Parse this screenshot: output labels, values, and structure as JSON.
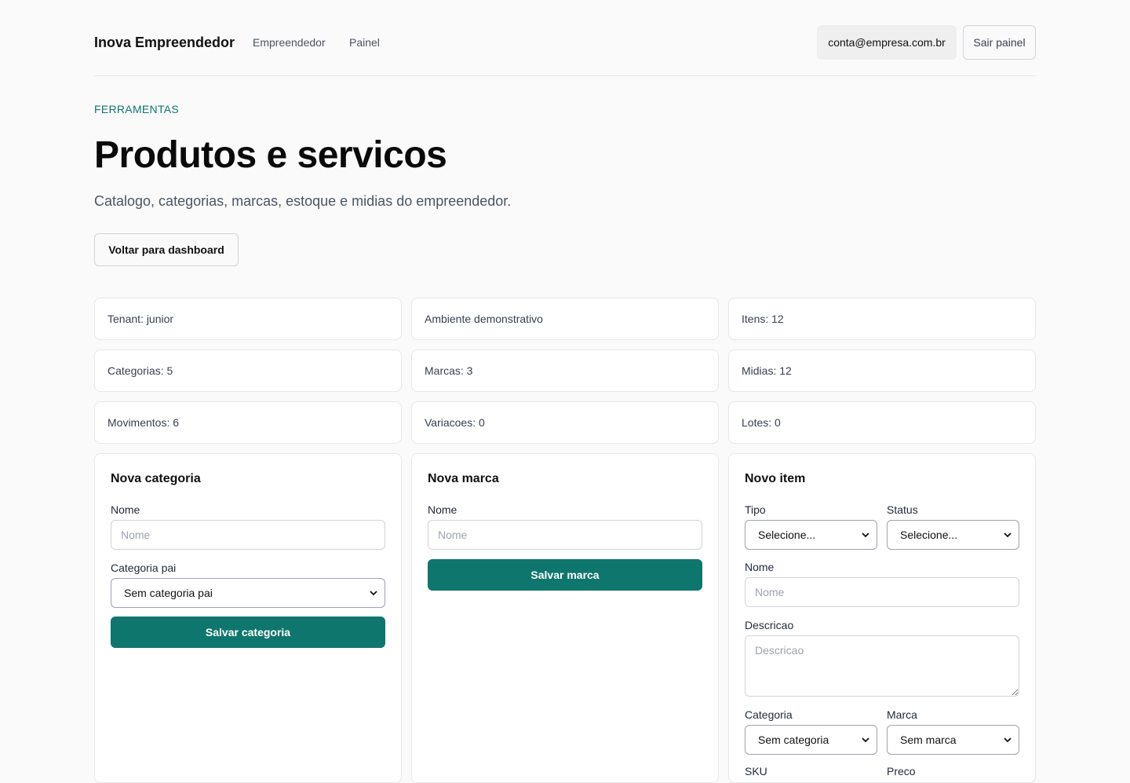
{
  "header": {
    "brand": "Inova Empreendedor",
    "nav": [
      "Empreendedor",
      "Painel"
    ],
    "account_email": "conta@empresa.com.br",
    "logout_label": "Sair painel"
  },
  "page": {
    "eyebrow": "FERRAMENTAS",
    "title": "Produtos e servicos",
    "subtitle": "Catalogo, categorias, marcas, estoque e midias do empreendedor.",
    "back_label": "Voltar para dashboard"
  },
  "stats": [
    "Tenant: junior",
    "Ambiente demonstrativo",
    "Itens: 12",
    "Categorias: 5",
    "Marcas: 3",
    "Midias: 12",
    "Movimentos: 6",
    "Variacoes: 0",
    "Lotes: 0"
  ],
  "forms": {
    "category": {
      "title": "Nova categoria",
      "name_label": "Nome",
      "name_placeholder": "Nome",
      "parent_label": "Categoria pai",
      "parent_value": "Sem categoria pai",
      "save_label": "Salvar categoria"
    },
    "brand": {
      "title": "Nova marca",
      "name_label": "Nome",
      "name_placeholder": "Nome",
      "save_label": "Salvar marca"
    },
    "item": {
      "title": "Novo item",
      "type_label": "Tipo",
      "type_value": "Selecione...",
      "status_label": "Status",
      "status_value": "Selecione...",
      "name_label": "Nome",
      "name_placeholder": "Nome",
      "description_label": "Descricao",
      "description_placeholder": "Descricao",
      "category_label": "Categoria",
      "category_value": "Sem categoria",
      "brand_label": "Marca",
      "brand_value": "Sem marca",
      "sku_label": "SKU",
      "price_label": "Preco"
    }
  },
  "colors": {
    "accent": "#0f766e",
    "background": "#fafafa"
  }
}
